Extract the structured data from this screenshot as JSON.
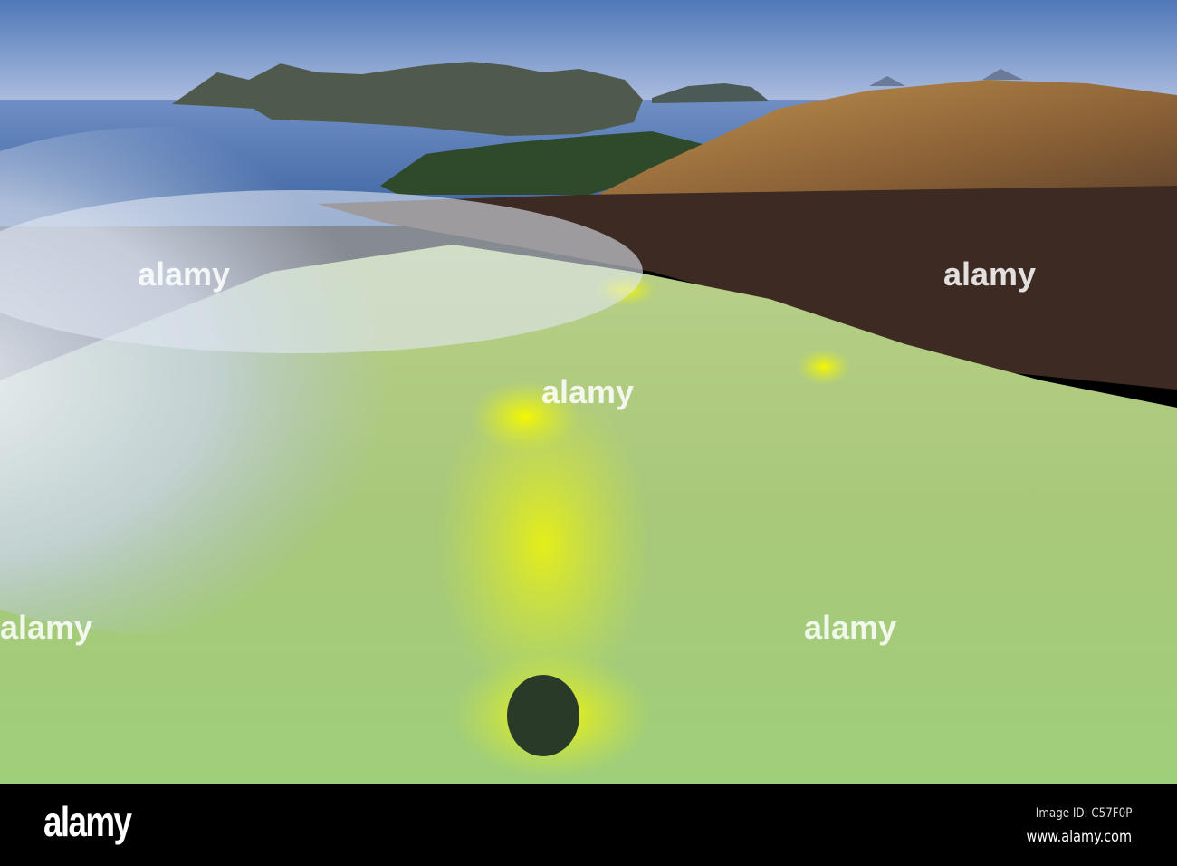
{
  "photo": {
    "subject": "Sulfur fumaroles on volcano crater rim overlooking islands and sea",
    "colors": {
      "sky": "#6f8fc6",
      "sea": "#3f67a3",
      "sulfur": "#d9f04a",
      "ground": "#3a2a22",
      "ridge": "#a0763c"
    }
  },
  "watermark": {
    "text": "alamy"
  },
  "footer": {
    "logo": "alamy",
    "image_id": "Image ID: C57F0P",
    "url": "www.alamy.com"
  }
}
